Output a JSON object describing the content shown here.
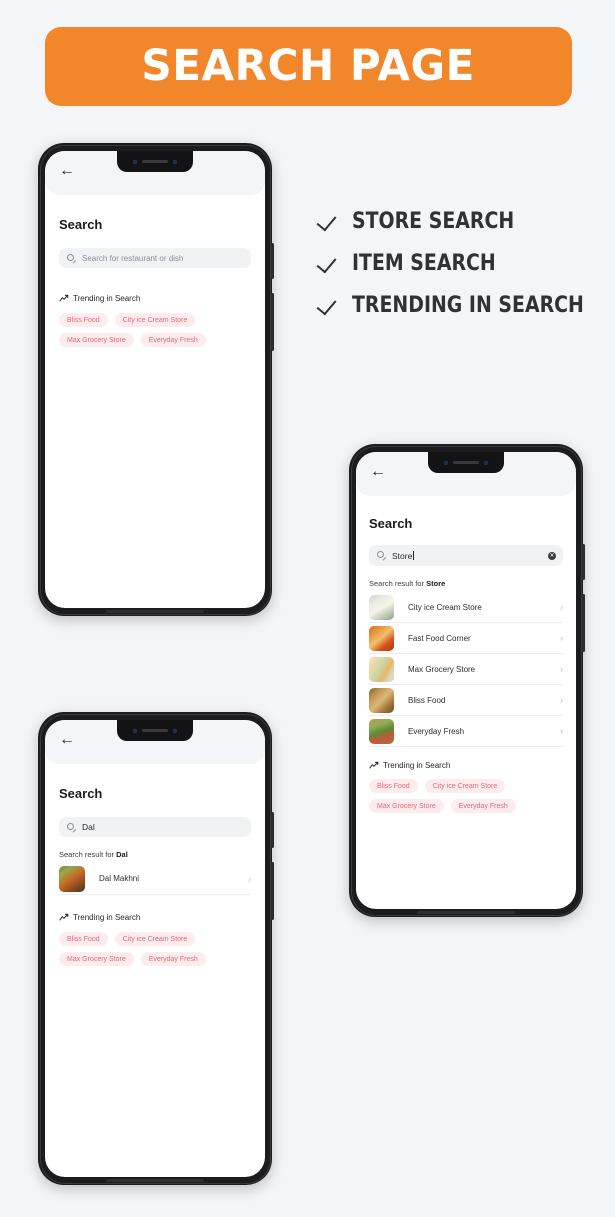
{
  "banner": {
    "title": "SEARCH PAGE",
    "color": "#f2862a"
  },
  "features": [
    {
      "icon": "check-icon",
      "label": "STORE SEARCH"
    },
    {
      "icon": "check-icon",
      "label": "ITEM SEARCH"
    },
    {
      "icon": "check-icon",
      "label": "TRENDING IN SEARCH"
    }
  ],
  "trending": {
    "heading": "Trending in Search",
    "icon": "trending-up-icon",
    "chips": [
      "Bliss Food",
      "City ice Cream Store",
      "Max Grocery Store",
      "Everyday Fresh"
    ],
    "chip_bg": "#fdecee",
    "chip_color": "#e2697a"
  },
  "phone_empty": {
    "back_icon": "back-arrow-icon",
    "title": "Search",
    "search": {
      "icon": "search-icon",
      "value": "",
      "placeholder": "Search for restaurant or dish"
    }
  },
  "phone_store": {
    "back_icon": "back-arrow-icon",
    "title": "Search",
    "search": {
      "icon": "search-icon",
      "value": "Store",
      "placeholder": "Search for restaurant or dish",
      "clear_icon": "clear-circle-icon"
    },
    "result_prefix": "Search result for ",
    "result_query": "Store",
    "results": [
      {
        "name": "City ice Cream Store",
        "thumb": "ice-cream-bowl-photo",
        "chevron": "chevron-right-icon"
      },
      {
        "name": "Fast Food Corner",
        "thumb": "pizza-photo",
        "chevron": "chevron-right-icon"
      },
      {
        "name": "Max Grocery Store",
        "thumb": "grocery-spread-photo",
        "chevron": "chevron-right-icon"
      },
      {
        "name": "Bliss Food",
        "thumb": "food-platter-photo",
        "chevron": "chevron-right-icon"
      },
      {
        "name": "Everyday Fresh",
        "thumb": "vegetables-photo",
        "chevron": "chevron-right-icon"
      }
    ]
  },
  "phone_item": {
    "back_icon": "back-arrow-icon",
    "title": "Search",
    "search": {
      "icon": "search-icon",
      "value": "Dal",
      "placeholder": "Search for restaurant or dish"
    },
    "result_prefix": "Search result for ",
    "result_query": "Dal",
    "results": [
      {
        "name": "Dal Makhni",
        "thumb": "dal-makhni-photo",
        "chevron": "chevron-right-icon"
      }
    ]
  }
}
